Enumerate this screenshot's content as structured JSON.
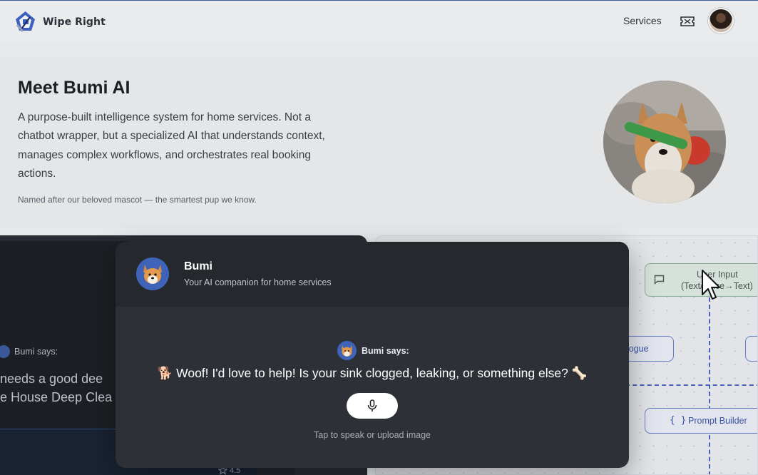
{
  "header": {
    "brand_name": "Wipe Right",
    "nav_services": "Services"
  },
  "hero": {
    "title": "Meet Bumi AI",
    "description": "A purpose-built intelligence system for home services. Not a chatbot wrapper, but a specialized AI that understands context, manages complex workflows, and orchestrates real booking actions.",
    "note": "Named after our beloved mascot — the smartest pup we know."
  },
  "background_demo": {
    "says_label": "Bumi says:",
    "line1": "needs a good dee",
    "line2": "e House Deep Clea",
    "rating": "4.5"
  },
  "diagram": {
    "user_input_line1": "User Input",
    "user_input_line2": "(Text/Voice→Text)",
    "dialogue_label": "alogue",
    "prompt_builder_icon": "{ }",
    "prompt_builder_label": "Prompt Builder"
  },
  "modal": {
    "name": "Bumi",
    "subtitle": "Your AI companion for home services",
    "says_label": "Bumi says:",
    "message": "🐕 Woof! I'd love to help! Is your sink clogged, leaking, or something else? 🦴",
    "hint": "Tap to speak or upload image"
  },
  "colors": {
    "accent": "#3e63b8",
    "modal_bg": "#2d3036",
    "modal_header_bg": "#25282d",
    "diagram_node_border": "#6b83cc",
    "user_input_border": "#8cb59a"
  },
  "icons": {
    "brand": "wipe-right-logo-icon",
    "ticket": "ticket-icon",
    "mic": "microphone-icon",
    "chat": "chat-bubble-icon",
    "star": "star-icon",
    "cursor": "mouse-pointer-icon"
  }
}
